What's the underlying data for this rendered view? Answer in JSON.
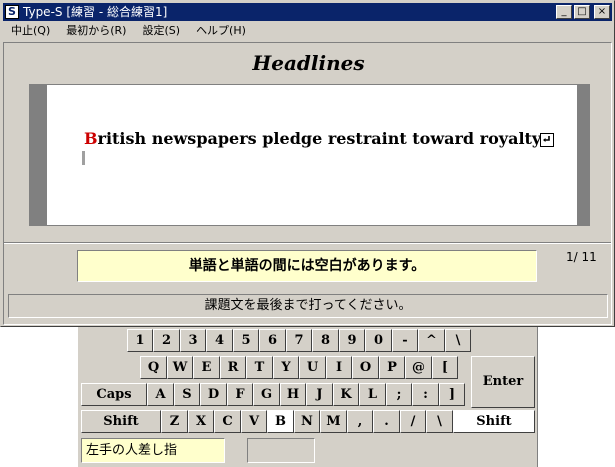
{
  "window": {
    "title": "Type-S [練習 - 総合練習1]",
    "app_icon": "S",
    "controls": {
      "minimize": "_",
      "maximize": "□",
      "close": "×"
    }
  },
  "menu": {
    "items": [
      "中止(Q)",
      "最初から(R)",
      "設定(S)",
      "ヘルプ(H)"
    ]
  },
  "heading": "Headlines",
  "exercise": {
    "first_letter": "B",
    "rest": "ritish newspapers pledge restraint toward royalty",
    "end_icon": "return-icon"
  },
  "hint": "単語と単語の間には空白があります。",
  "counter": "1/ 11",
  "status": "課題文を最後まで打ってください。",
  "finger": "左手の人差し指",
  "keyboard": {
    "row1": [
      "1",
      "2",
      "3",
      "4",
      "5",
      "6",
      "7",
      "8",
      "9",
      "0",
      "-",
      "^",
      "\\"
    ],
    "row2": [
      "Q",
      "W",
      "E",
      "R",
      "T",
      "Y",
      "U",
      "I",
      "O",
      "P",
      "@",
      "["
    ],
    "enter": "Enter",
    "row3": [
      "Caps",
      "A",
      "S",
      "D",
      "F",
      "G",
      "H",
      "J",
      "K",
      "L",
      ";",
      ":",
      "]"
    ],
    "row4": [
      "Shift",
      "Z",
      "X",
      "C",
      "V",
      "B",
      "N",
      "M",
      ",",
      ".",
      "/",
      "\\",
      "Shift"
    ],
    "highlighted": "B",
    "highlight_color": "#ffffff"
  },
  "colors": {
    "titlebar": "#0a246a",
    "hint_bg": "#ffffcc",
    "first_letter": "#cc0000"
  }
}
